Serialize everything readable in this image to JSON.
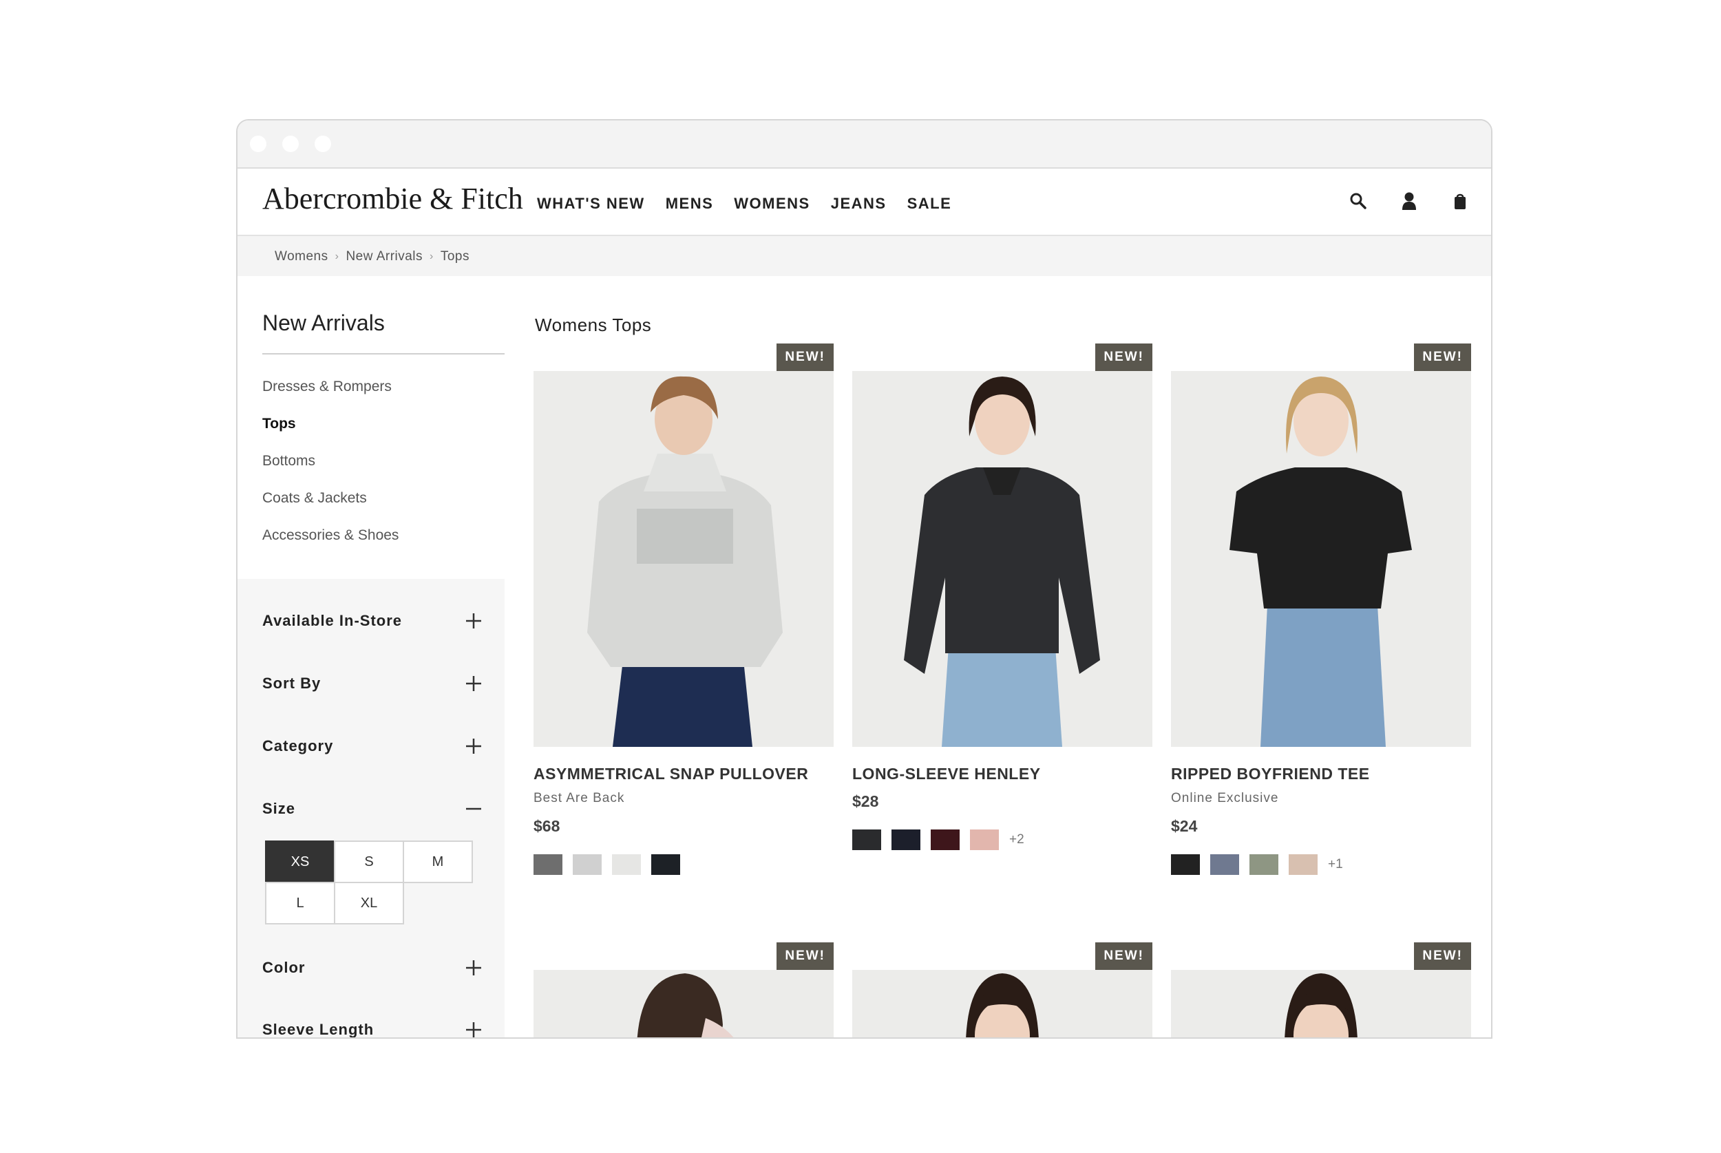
{
  "header": {
    "logo": "Abercrombie & Fitch",
    "nav": [
      "WHAT'S NEW",
      "MENS",
      "WOMENS",
      "JEANS",
      "SALE"
    ]
  },
  "breadcrumb": [
    "Womens",
    "New Arrivals",
    "Tops"
  ],
  "sidebar": {
    "title": "New Arrivals",
    "links": [
      "Dresses & Rompers",
      "Tops",
      "Bottoms",
      "Coats & Jackets",
      "Accessories & Shoes"
    ],
    "active_link": "Tops",
    "filters": [
      "Available In-Store",
      "Sort By",
      "Category",
      "Size",
      "Color",
      "Sleeve Length"
    ],
    "expanded_filter": "Size",
    "sizes": [
      "XS",
      "S",
      "M",
      "L",
      "XL"
    ],
    "selected_size": "XS"
  },
  "main": {
    "title": "Womens Tops",
    "badge": "NEW!",
    "products": [
      {
        "name": "ASYMMETRICAL SNAP PULLOVER",
        "subtitle": "Best Are Back",
        "price": "$68",
        "swatches": [
          "#6e6e6e",
          "#d0d0d0",
          "#e6e6e4",
          "#1d2126"
        ],
        "more": ""
      },
      {
        "name": "LONG-SLEEVE HENLEY",
        "subtitle": "",
        "price": "$28",
        "swatches": [
          "#2a2b2d",
          "#1c1f2b",
          "#3e161b",
          "#e2b6ad"
        ],
        "more": "+2"
      },
      {
        "name": "RIPPED BOYFRIEND TEE",
        "subtitle": "Online Exclusive",
        "price": "$24",
        "swatches": [
          "#222222",
          "#6f7990",
          "#8e9683",
          "#d8c0b0"
        ],
        "more": "+1"
      }
    ]
  }
}
